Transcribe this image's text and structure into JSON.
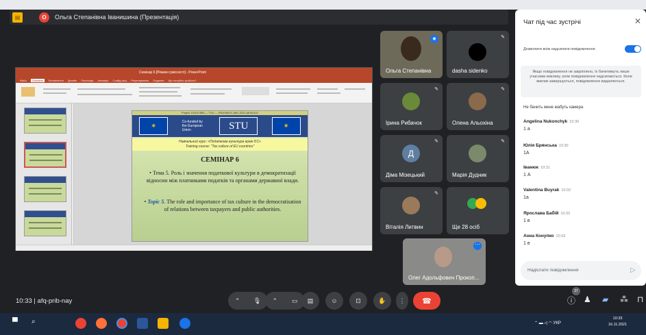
{
  "banner": {
    "badge": "O",
    "title": "Ольга Степанівна Іванишина (Презентація)"
  },
  "presentation": {
    "window_title": "Семінар 6 [Режим сумісності] - PowerPoint",
    "tabs": [
      "Файл",
      "Основне",
      "Вставлення",
      "Дизайн",
      "Переходи",
      "Анімація",
      "Слайд-шоу",
      "Рецензування",
      "Подання",
      "Що потрібно зробити?"
    ],
    "slide": {
      "project_line": "Project 101047855 — TSU — ERASMUS-JMO-2021-MODULE",
      "eu_text": "Co-funded by the European Union",
      "logo": "STU",
      "course_ua": "Навчальний курс: «Податкова культура країн ЄС»",
      "course_en": "Training course: \"Tax culture of EU countries\"",
      "heading": "СЕМІНАР 6",
      "bullet1": "Тема 5. Роль і значення податкової культури в демократизації відносин між платниками податків та органами державної влади.",
      "bullet2_label": "Topic 5",
      "bullet2": ". The role and importance of tax culture in the democratisation of relations between taxpayers and public authorities."
    }
  },
  "participants": [
    {
      "name": "Ольга Степанівна"
    },
    {
      "name": "dasha sidenko"
    },
    {
      "name": "Ірина Рибачок"
    },
    {
      "name": "Олена Альохіна"
    },
    {
      "name": "Діма Мізецький",
      "initial": "Д"
    },
    {
      "name": "Марія Дудник"
    },
    {
      "name": "Віталія Литвин"
    },
    {
      "name": "Ще 28 осіб"
    },
    {
      "name": "Олег Адольфович Прокоп..."
    }
  ],
  "chat": {
    "title": "Чат під час зустрічі",
    "close": "✕",
    "toggle_label": "Дозволити всім надсилати повідомлення",
    "note": "Якщо повідомлення не закріплено, їх бачитимуть лише учасники виклику, коли повідомлення надсилаються. Коли виклик завершується, повідомлення видаляються.",
    "pinned": "Не бачить мене мабуть камера",
    "messages": [
      {
        "author": "Angelina Nukonchyk",
        "time": "10:30",
        "text": "1 а"
      },
      {
        "author": "Юлія Брянська",
        "time": "10:30",
        "text": "1А"
      },
      {
        "author": "Іванюк",
        "time": "10:31",
        "text": "1 А"
      },
      {
        "author": "Valentina Buyrak",
        "time": "10:32",
        "text": "1а"
      },
      {
        "author": "Ярослава Бабій",
        "time": "10:33",
        "text": "1 в"
      },
      {
        "author": "Анна Конупко",
        "time": "10:33",
        "text": "1 в"
      }
    ],
    "input_placeholder": "Надіслати повідомлення"
  },
  "meeting": {
    "time": "10:33",
    "separator": "|",
    "code": "afq-prib-nay",
    "participant_count": "37"
  },
  "taskbar": {
    "time": "10:33",
    "date": "16.11.2021",
    "lang": "УКР"
  },
  "colors": {
    "accent": "#1a73e8",
    "end_call": "#ea4335",
    "background": "#202124"
  }
}
